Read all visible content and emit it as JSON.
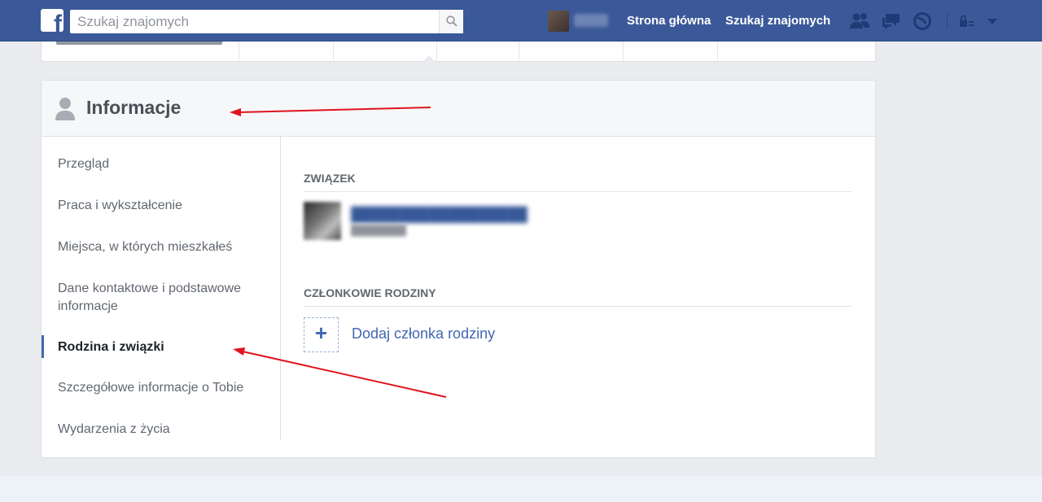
{
  "topbar": {
    "logo_letter": "f",
    "search_placeholder": "Szukaj znajomych",
    "nav_home": "Strona główna",
    "nav_find_friends": "Szukaj znajomych",
    "accent": "#3b5998"
  },
  "about": {
    "title": "Informacje",
    "sidebar": [
      {
        "label": "Przegląd"
      },
      {
        "label": "Praca i wykształcenie"
      },
      {
        "label": "Miejsca, w których mieszkałeś"
      },
      {
        "label": "Dane kontaktowe i podstawowe informacje"
      },
      {
        "label": "Rodzina i związki",
        "active": true
      },
      {
        "label": "Szczegółowe informacje o Tobie"
      },
      {
        "label": "Wydarzenia z życia"
      }
    ],
    "relationship_heading": "ZWIĄZEK",
    "family_heading": "CZŁONKOWIE RODZINY",
    "add_family_plus": "+",
    "add_family_label": "Dodaj członka rodziny"
  },
  "annotation_color": "#e0141e"
}
